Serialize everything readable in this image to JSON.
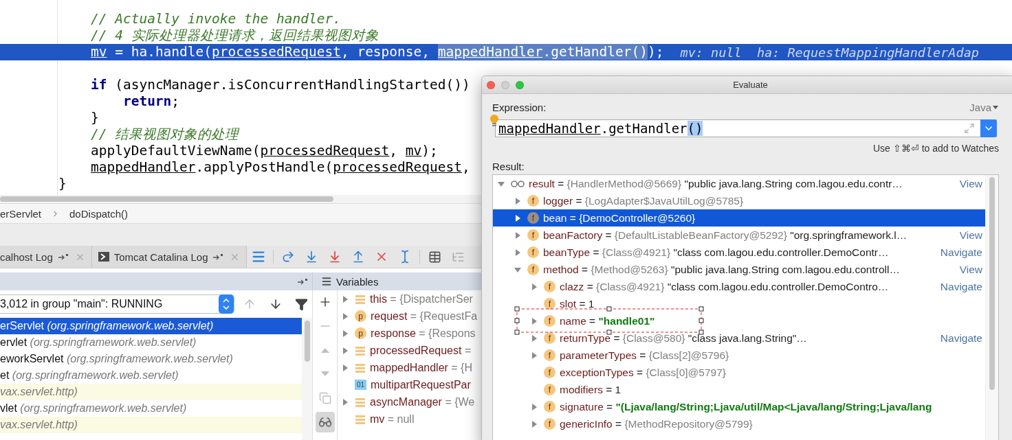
{
  "editor": {
    "lines": [
      {
        "current": false,
        "segments": [
          {
            "kind": "comment",
            "text": "// Actually invoke the handler."
          }
        ]
      },
      {
        "current": false,
        "segments": [
          {
            "kind": "comment",
            "text": "// 4 实际处理器处理请求，返回结果视图对象"
          }
        ]
      },
      {
        "current": true,
        "segments": [
          {
            "kind": "ref",
            "text": "mv"
          },
          {
            "kind": "plain",
            "text": " = ha.handle("
          },
          {
            "kind": "ref",
            "text": "processedRequest"
          },
          {
            "kind": "plain",
            "text": ", response, "
          },
          {
            "kind": "selected_ref",
            "text": "mappedHandler"
          },
          {
            "kind": "selected",
            "text": ".getHandler()"
          },
          {
            "kind": "plain",
            "text": ");"
          }
        ],
        "inline_values": "mv: null  ha: RequestMappingHandlerAdap"
      },
      {
        "current": false
      },
      {
        "current": false,
        "segments": [
          {
            "kind": "keyword",
            "text": "if"
          },
          {
            "kind": "plain",
            "text": " (asyncManager.isConcurrentHandlingStarted())"
          }
        ],
        "children": [
          {
            "current": false,
            "segments": [
              {
                "kind": "keyword",
                "text": "return"
              },
              {
                "kind": "plain",
                "text": ";"
              }
            ]
          }
        ]
      },
      {
        "current": false,
        "segments": [
          {
            "kind": "plain",
            "text": "}"
          }
        ]
      },
      {
        "current": false,
        "segments": [
          {
            "kind": "comment",
            "text": "// 结果视图对象的处理"
          }
        ]
      },
      {
        "current": false,
        "segments": [
          {
            "kind": "plain",
            "text": "applyDefaultViewName("
          },
          {
            "kind": "ref",
            "text": "processedRequest"
          },
          {
            "kind": "plain",
            "text": ", "
          },
          {
            "kind": "ref",
            "text": "mv"
          },
          {
            "kind": "plain",
            "text": ");"
          }
        ]
      },
      {
        "current": false,
        "segments": [
          {
            "kind": "ref",
            "text": "mappedHandler"
          },
          {
            "kind": "plain",
            "text": ".applyPostHandle("
          },
          {
            "kind": "ref",
            "text": "processedRequest"
          },
          {
            "kind": "plain",
            "text": ","
          }
        ]
      }
    ],
    "closing": {
      "current": false,
      "segments": [
        {
          "kind": "plain",
          "text": "}"
        }
      ]
    }
  },
  "breadcrumb": [
    "erServlet",
    "doDispatch()"
  ],
  "tool_tabs": [
    {
      "kind": "plain",
      "label": "calhost Log"
    },
    {
      "kind": "console",
      "label": "Tomcat Catalina Log"
    }
  ],
  "debugger": {
    "panel_title": "Variables",
    "thread": "3,012 in group \"main\": RUNNING",
    "thread_up_disabled": true,
    "thread_down_disabled": false,
    "show_watches": true,
    "frames": [
      {
        "name": "erServlet",
        "package": "(org.springframework.web.servlet)",
        "selected": true,
        "library": false
      },
      {
        "name": "ervlet",
        "package": "(org.springframework.web.servlet)",
        "selected": false,
        "library": false
      },
      {
        "name": "eworkServlet",
        "package": "(org.springframework.web.servlet)",
        "selected": false,
        "library": false
      },
      {
        "name": "et",
        "package": "(org.springframework.web.servlet)",
        "selected": false,
        "library": false
      },
      {
        "package": "vax.servlet.http)",
        "selected": false,
        "library": true
      },
      {
        "name": "vlet",
        "package": "(org.springframework.web.servlet)",
        "selected": false,
        "library": false
      },
      {
        "package": "vax.servlet.http)",
        "selected": false,
        "library": true
      }
    ],
    "variables": [
      {
        "kind": "local",
        "name": "this",
        "value": "= {DispatcherSer",
        "expandable": true
      },
      {
        "kind": "param",
        "badge": "p",
        "name": "request",
        "value": "= {RequestFa",
        "expandable": true
      },
      {
        "kind": "param",
        "badge": "p",
        "name": "response",
        "value": "= {Respons",
        "expandable": true
      },
      {
        "kind": "local",
        "name": "processedRequest",
        "value": "=",
        "expandable": true
      },
      {
        "kind": "local",
        "name": "mappedHandler",
        "value": "= {H",
        "expandable": true
      },
      {
        "kind": "primitive",
        "badge": "01",
        "name": "multipartRequestPar",
        "expandable": false
      },
      {
        "kind": "local",
        "name": "asyncManager",
        "value": "= {We",
        "expandable": true
      },
      {
        "kind": "local",
        "name": "mv",
        "value": "= null",
        "expandable": false
      }
    ]
  },
  "evaluate": {
    "title": "Evaluate",
    "expression_label": "Expression:",
    "language": "Java",
    "expression": [
      {
        "kind": "ref",
        "text": "mappedHandler"
      },
      {
        "kind": "plain",
        "text": ".getHandler"
      },
      {
        "kind": "selected",
        "text": "()"
      }
    ],
    "hint": "Use ⇧⌘⏎ to add to Watches",
    "result_label": "Result:",
    "tree": [
      {
        "kind": "watch",
        "name": "result",
        "eq": "=",
        "ref": "{HandlerMethod@5669}",
        "detail": "\"public java.lang.String com.lagou.edu.contr…",
        "link": "View",
        "expandable": true,
        "expanded": true,
        "selected": false,
        "boxed": false,
        "children": [
          {
            "kind": "field",
            "badge": "f",
            "name": "logger",
            "eq": "=",
            "ref": "{LogAdapter$JavaUtilLog@5785}",
            "expandable": true,
            "expanded": false,
            "selected": false,
            "boxed": false
          },
          {
            "kind": "field",
            "badge": "f",
            "name": "bean",
            "eq": "=",
            "ref": "{DemoController@5260}",
            "expandable": true,
            "expanded": false,
            "selected": true,
            "boxed": false
          },
          {
            "kind": "field",
            "badge": "f",
            "name": "beanFactory",
            "eq": "=",
            "ref": "{DefaultListableBeanFactory@5292}",
            "detail": "\"org.springframework.l…",
            "link": "View",
            "expandable": true,
            "expanded": false,
            "selected": false,
            "boxed": false
          },
          {
            "kind": "field",
            "badge": "f",
            "name": "beanType",
            "eq": "=",
            "ref": "{Class@4921}",
            "detail": "\"class com.lagou.edu.controller.DemoContr…",
            "link": "Navigate",
            "expandable": true,
            "expanded": false,
            "selected": false,
            "boxed": false
          },
          {
            "kind": "field",
            "badge": "f",
            "name": "method",
            "eq": "=",
            "ref": "{Method@5263}",
            "detail": "\"public java.lang.String com.lagou.edu.controll…",
            "link": "View",
            "expandable": true,
            "expanded": true,
            "selected": false,
            "boxed": false,
            "children": [
              {
                "kind": "field",
                "badge": "f",
                "name": "clazz",
                "eq": "=",
                "ref": "{Class@4921}",
                "detail": "\"class com.lagou.edu.controller.DemoContro…",
                "link": "Navigate",
                "expandable": true,
                "expanded": false,
                "selected": false,
                "boxed": false
              },
              {
                "kind": "field",
                "badge": "f",
                "name": "slot",
                "eq": "=",
                "number": "1",
                "expandable": false,
                "selected": false,
                "boxed": false
              },
              {
                "kind": "field",
                "badge": "f",
                "name": "name",
                "eq": "=",
                "string": "\"handle01\"",
                "expandable": true,
                "expanded": false,
                "selected": false,
                "boxed": true
              },
              {
                "kind": "field",
                "badge": "f",
                "name": "returnType",
                "eq": "=",
                "ref": "{Class@580}",
                "detail": "\"class java.lang.String\"…",
                "link": "Navigate",
                "expandable": true,
                "expanded": false,
                "selected": false,
                "boxed": false
              },
              {
                "kind": "field",
                "badge": "f",
                "name": "parameterTypes",
                "eq": "=",
                "ref": "{Class[2]@5796}",
                "expandable": true,
                "expanded": false,
                "selected": false,
                "boxed": false
              },
              {
                "kind": "field",
                "badge": "f",
                "name": "exceptionTypes",
                "eq": "=",
                "ref": "{Class[0]@5797}",
                "expandable": false,
                "selected": false,
                "boxed": false
              },
              {
                "kind": "field",
                "badge": "f",
                "name": "modifiers",
                "eq": "=",
                "number": "1",
                "expandable": false,
                "selected": false,
                "boxed": false
              },
              {
                "kind": "field",
                "badge": "f",
                "name": "signature",
                "eq": "=",
                "string": "\"(Ljava/lang/String;Ljava/util/Map<Ljava/lang/String;Ljava/lang",
                "expandable": true,
                "expanded": false,
                "selected": false,
                "boxed": false
              },
              {
                "kind": "field",
                "badge": "f",
                "name": "genericInfo",
                "eq": "=",
                "ref": "{MethodRepository@5799}",
                "expandable": true,
                "expanded": false,
                "selected": false,
                "boxed": false
              }
            ]
          }
        ]
      }
    ]
  }
}
